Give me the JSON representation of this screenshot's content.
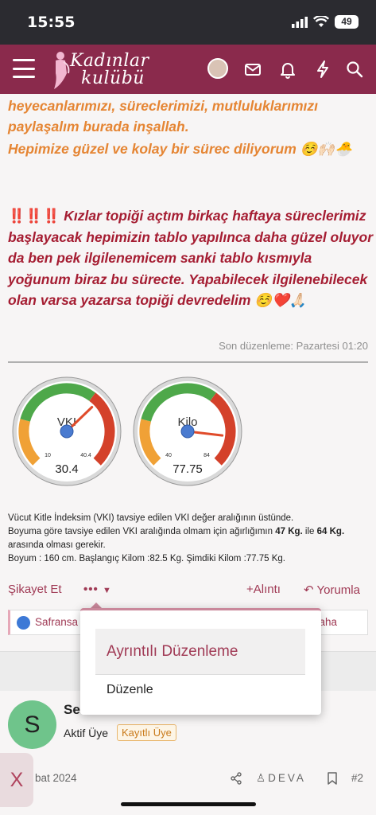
{
  "status_bar": {
    "time": "15:55",
    "battery": "49"
  },
  "navbar": {
    "logo_line1": "Kadınlar",
    "logo_line2": "kulübü"
  },
  "post": {
    "line_orange_1": "heyecanlarımızı, süreclerimizi, mutluluklarımızı paylaşalım burada inşallah.",
    "line_orange_2": "Hepimize güzel ve kolay bir sürec diliyorum ☺️🙌🏻🐣",
    "bangs": "‼️‼️‼️",
    "line_red": "Kızlar topiği açtım birkaç haftaya süreclerimiz başlayacak hepimizin tablo yapılınca daha güzel oluyor da ben pek ilgilenemicem sanki tablo kısmıyla yoğunum biraz bu sürecte. Yapabilecek ilgilenebilecek olan varsa yazarsa topiği devredelim ☺️❤️🙏🏻",
    "edited": "Son düzenleme: Pazartesi 01:20"
  },
  "gauges": [
    {
      "label": "VKI",
      "value_text": "30.4",
      "min_label": "10",
      "max_label": "40.4",
      "value": 30.4,
      "min": 10,
      "max": 40.4
    },
    {
      "label": "Kilo",
      "value_text": "77.75",
      "min_label": "40",
      "max_label": "84",
      "value": 77.75,
      "min": 40,
      "max": 84
    }
  ],
  "signature": {
    "line1": "Vücut Kitle İndeksim (VKI) tavsiye edilen VKI değer aralığının üstünde.",
    "line2_pre": "Boyuma göre tavsiye edilen VKI aralığında olmam için ağırlığımın ",
    "line2_min": "47 Kg.",
    "line2_mid": " ile ",
    "line2_max": "64 Kg.",
    "line2_post": " arasında olması gerekir.",
    "line3": "Boyum : 160 cm. Başlangıç Kilom :82.5 Kg. Şimdiki Kilom :77.75 Kg."
  },
  "actions": {
    "report": "Şikayet Et",
    "more": "•••",
    "quote": "+Alıntı",
    "reply": "Yorumla"
  },
  "likes": {
    "name": "Safransa",
    "more": "aha"
  },
  "dropdown": {
    "item1": "Ayrıntılı Düzenleme",
    "item2": "Düzenle"
  },
  "post2": {
    "avatar_letter": "S",
    "name": "Se",
    "role": "Aktif Üye",
    "badge": "Kayıtlı Üye",
    "date": "bat 2024",
    "author": "DEVA",
    "number": "#2"
  },
  "close_chip": "X",
  "colors": {
    "brand": "#8a2a4c",
    "orange": "#e58533",
    "red_text": "#a51d32",
    "link": "#a03a55"
  }
}
